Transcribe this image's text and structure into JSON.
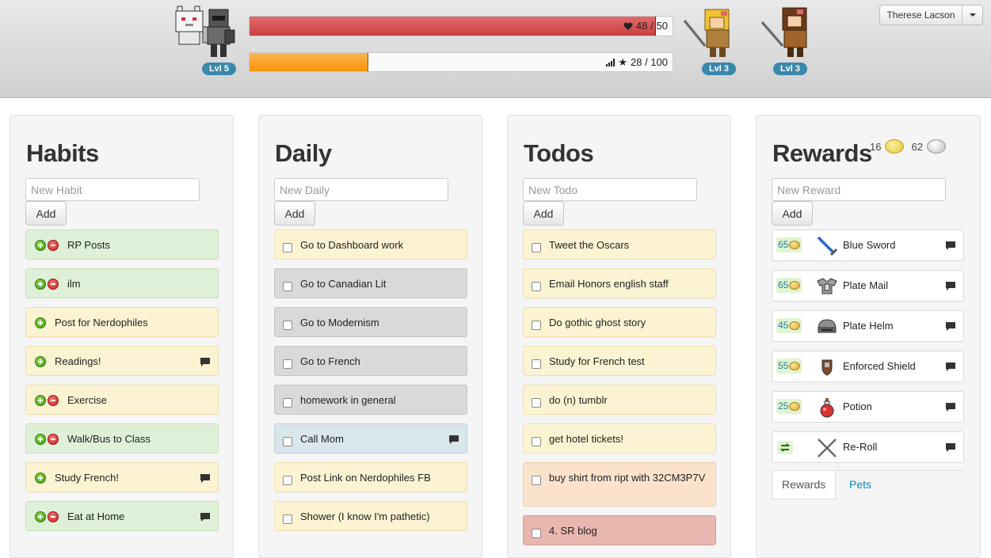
{
  "header": {
    "main_avatar_level": "Lvl 5",
    "hp": {
      "icon": "heart-icon",
      "current": 48,
      "max": 50,
      "text_current": "48",
      "text_max": "/ 50",
      "fraction": 0.96
    },
    "xp": {
      "icons": [
        "signal-icon",
        "star-icon"
      ],
      "text": "28 / 100",
      "fraction": 0.28
    },
    "party": [
      {
        "level": "Lvl 3",
        "sprite": "blonde-warrior-avatar"
      },
      {
        "level": "Lvl 3",
        "sprite": "brunette-warrior-avatar"
      }
    ],
    "user_menu": {
      "name": "Therese Lacson"
    }
  },
  "habits": {
    "title": "Habits",
    "placeholder": "New Habit",
    "add_label": "Add",
    "items": [
      {
        "label": "RP Posts",
        "color": "green",
        "plus": true,
        "minus": true,
        "comment": false
      },
      {
        "label": "ilm",
        "color": "green",
        "plus": true,
        "minus": true,
        "comment": false
      },
      {
        "label": "Post for Nerdophiles",
        "color": "yellow",
        "plus": true,
        "minus": false,
        "comment": false
      },
      {
        "label": "Readings!",
        "color": "yellow",
        "plus": true,
        "minus": false,
        "comment": true
      },
      {
        "label": "Exercise",
        "color": "yellow",
        "plus": true,
        "minus": true,
        "comment": false
      },
      {
        "label": "Walk/Bus to Class",
        "color": "green",
        "plus": true,
        "minus": true,
        "comment": false
      },
      {
        "label": "Study French!",
        "color": "yellow",
        "plus": true,
        "minus": false,
        "comment": true
      },
      {
        "label": "Eat at Home",
        "color": "green",
        "plus": true,
        "minus": true,
        "comment": true
      }
    ]
  },
  "daily": {
    "title": "Daily",
    "placeholder": "New Daily",
    "add_label": "Add",
    "items": [
      {
        "label": "Go to Dashboard work",
        "color": "yellow",
        "comment": false
      },
      {
        "label": "Go to Canadian Lit",
        "color": "gray",
        "comment": false
      },
      {
        "label": "Go to Modernism",
        "color": "gray",
        "comment": false
      },
      {
        "label": "Go to French",
        "color": "gray",
        "comment": false
      },
      {
        "label": "homework in general",
        "color": "gray",
        "comment": false
      },
      {
        "label": "Call Mom",
        "color": "blue",
        "comment": true
      },
      {
        "label": "Post Link on Nerdophiles FB",
        "color": "yellow",
        "comment": false
      },
      {
        "label": "Shower (I know I'm pathetic)",
        "color": "yellow",
        "comment": false
      }
    ]
  },
  "todos": {
    "title": "Todos",
    "placeholder": "New Todo",
    "add_label": "Add",
    "items": [
      {
        "label": "Tweet the Oscars",
        "color": "yellow"
      },
      {
        "label": "Email Honors english staff",
        "color": "yellow"
      },
      {
        "label": "Do gothic ghost story",
        "color": "yellow"
      },
      {
        "label": "Study for French test",
        "color": "yellow"
      },
      {
        "label": "do (n) tumblr",
        "color": "yellow"
      },
      {
        "label": "get hotel tickets!",
        "color": "yellow"
      },
      {
        "label": "buy shirt from ript with 32CM3P7V",
        "color": "orange"
      },
      {
        "label": "4. SR blog",
        "color": "red"
      }
    ]
  },
  "rewards": {
    "title": "Rewards",
    "gold": "16",
    "silver": "62",
    "placeholder": "New Reward",
    "add_label": "Add",
    "items": [
      {
        "price": "65",
        "label": "Blue Sword",
        "icon": "blue-sword-icon"
      },
      {
        "price": "65",
        "label": "Plate Mail",
        "icon": "plate-mail-icon"
      },
      {
        "price": "45",
        "label": "Plate Helm",
        "icon": "plate-helm-icon"
      },
      {
        "price": "55",
        "label": "Enforced Shield",
        "icon": "shield-icon"
      },
      {
        "price": "25",
        "label": "Potion",
        "icon": "potion-icon"
      },
      {
        "price": "",
        "label": "Re-Roll",
        "icon": "crossed-swords-icon"
      }
    ],
    "tabs": [
      "Rewards",
      "Pets"
    ]
  }
}
